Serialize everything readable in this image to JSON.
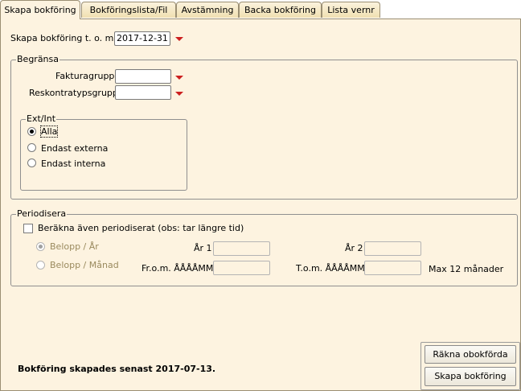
{
  "tabs": [
    {
      "label": "Skapa bokföring",
      "active": true
    },
    {
      "label": "Bokföringslista/Fil",
      "active": false
    },
    {
      "label": "Avstämning",
      "active": false
    },
    {
      "label": "Backa bokföring",
      "active": false
    },
    {
      "label": "Lista vernr",
      "active": false
    }
  ],
  "skapa": {
    "label": "Skapa bokföring t. o. m.",
    "date": "2017-12-31"
  },
  "begransa": {
    "legend": "Begränsa",
    "fakturagrupp_label": "Fakturagrupp",
    "fakturagrupp_value": "",
    "reskontra_label": "Reskontratypsgrupp",
    "reskontra_value": "",
    "extint": {
      "legend": "Ext/Int",
      "options": [
        "Alla",
        "Endast externa",
        "Endast interna"
      ],
      "selected": 0
    }
  },
  "periodisera": {
    "legend": "Periodisera",
    "checkbox_label": "Beräkna även periodiserat (obs: tar längre tid)",
    "checked": false,
    "belopp_ar": "Belopp / År",
    "belopp_manad": "Belopp / Månad",
    "ar1_label": "År 1",
    "ar2_label": "År 2",
    "from_label": "Fr.o.m. ÅÅÅÅMM",
    "tom_label": "T.o.m. ÅÅÅÅMM",
    "max_label": "Max 12 månader",
    "ar1_value": "",
    "ar2_value": "",
    "from_value": "",
    "tom_value": ""
  },
  "status": "Bokföring skapades senast 2017-07-13.",
  "buttons": {
    "rakna": "Räkna obokförda",
    "skapa": "Skapa bokföring"
  },
  "colors": {
    "panel": "#fdf3e0",
    "accent_arrow": "#cc1f1f"
  }
}
